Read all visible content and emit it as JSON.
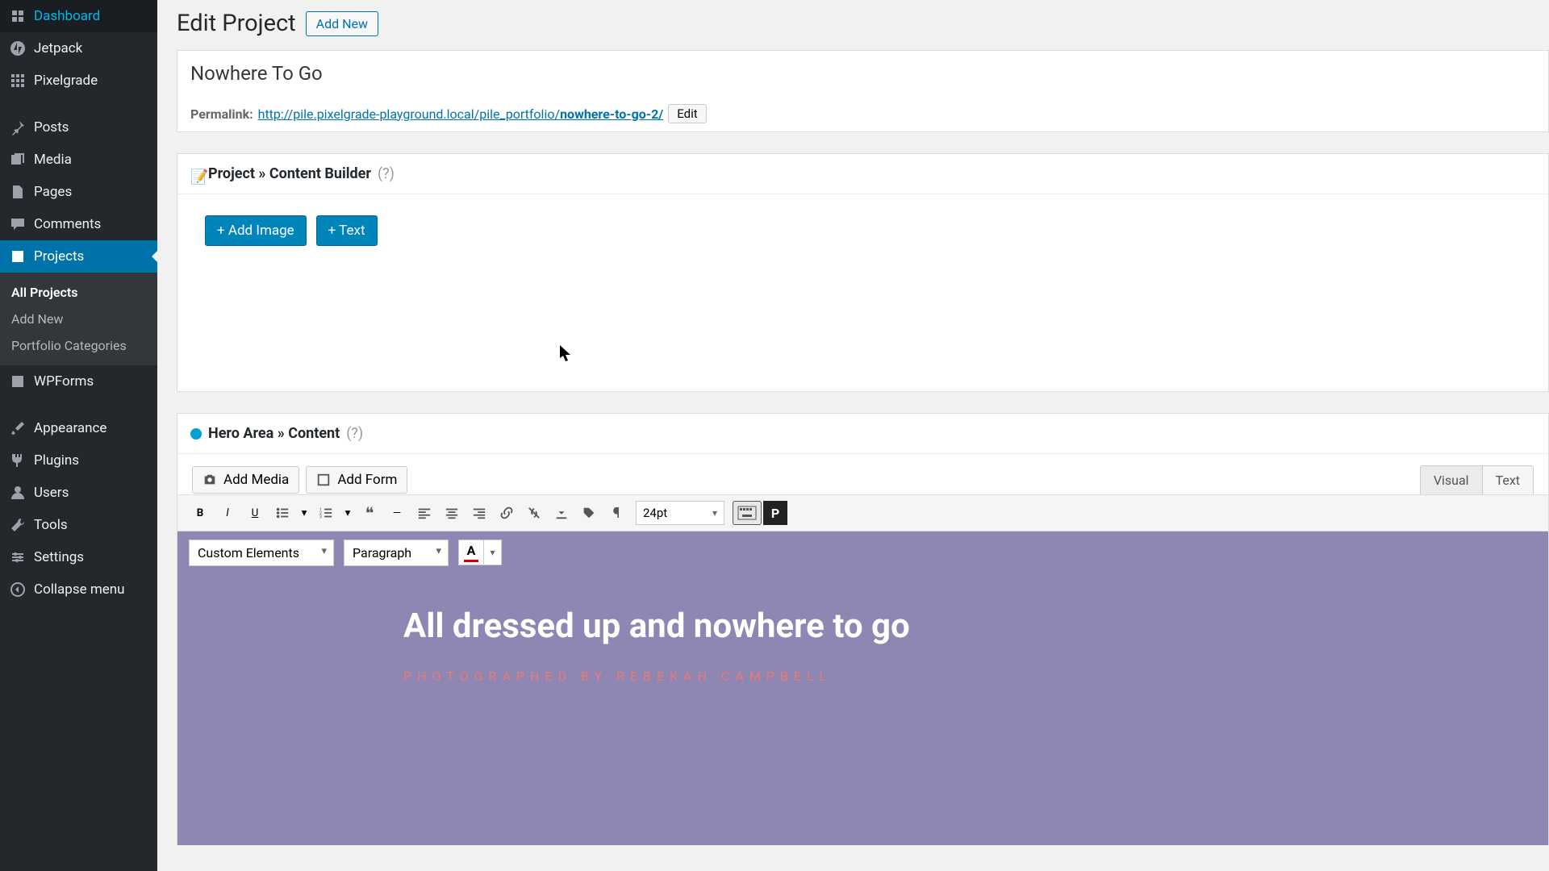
{
  "sidebar": {
    "items": [
      {
        "label": "Dashboard"
      },
      {
        "label": "Jetpack"
      },
      {
        "label": "Pixelgrade"
      },
      {
        "label": "Posts"
      },
      {
        "label": "Media"
      },
      {
        "label": "Pages"
      },
      {
        "label": "Comments"
      },
      {
        "label": "Projects"
      },
      {
        "label": "WPForms"
      },
      {
        "label": "Appearance"
      },
      {
        "label": "Plugins"
      },
      {
        "label": "Users"
      },
      {
        "label": "Tools"
      },
      {
        "label": "Settings"
      },
      {
        "label": "Collapse menu"
      }
    ],
    "submenu": {
      "all": "All Projects",
      "add": "Add New",
      "cats": "Portfolio Categories"
    }
  },
  "page": {
    "heading": "Edit Project",
    "add_new": "Add New",
    "title_value": "Nowhere To Go",
    "permalink_label": "Permalink:",
    "permalink_base": "http://pile.pixelgrade-playground.local/pile_portfolio/",
    "permalink_slug": "nowhere-to-go-2/",
    "edit": "Edit"
  },
  "builder": {
    "title": "Project » Content Builder",
    "help": "(?)",
    "add_image": "+ Add Image",
    "add_text": "+ Text"
  },
  "hero": {
    "title": "Hero Area » Content",
    "help": "(?)",
    "add_media": "Add Media",
    "add_form": "Add Form",
    "tab_visual": "Visual",
    "tab_text": "Text",
    "fontsize": "24pt",
    "custom_elements": "Custom Elements",
    "paragraph": "Paragraph",
    "content_title": "All dressed up and nowhere to go",
    "content_sub": "PHOTOGRAPHED BY REBEKAH CAMPBELL"
  }
}
